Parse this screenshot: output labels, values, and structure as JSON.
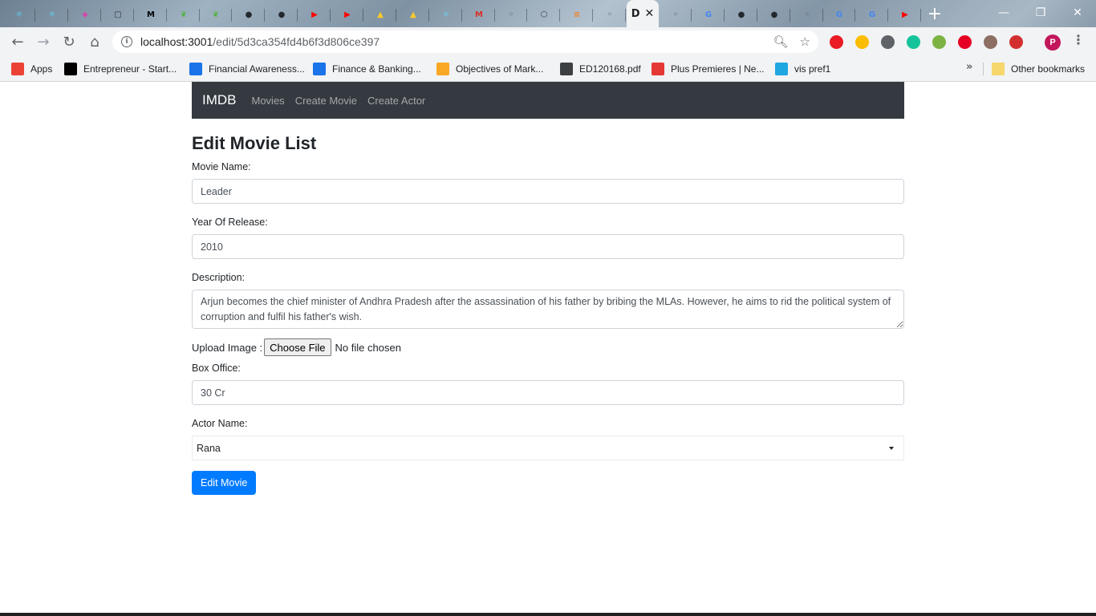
{
  "browser": {
    "tabs": [
      {
        "icon": "react-icon",
        "color": "#61dafb",
        "glyph": "⚛"
      },
      {
        "icon": "react-icon",
        "color": "#61dafb",
        "glyph": "⚛"
      },
      {
        "icon": "graphql-icon",
        "color": "#e535ab",
        "glyph": "◈"
      },
      {
        "icon": "square-icon",
        "color": "#263238",
        "glyph": "▢"
      },
      {
        "icon": "medium-icon",
        "color": "#000000",
        "glyph": "M"
      },
      {
        "icon": "mongodb-icon",
        "color": "#4db33d",
        "glyph": "❦"
      },
      {
        "icon": "mongodb-icon",
        "color": "#4db33d",
        "glyph": "❦"
      },
      {
        "icon": "github-icon",
        "color": "#24292e",
        "glyph": "●"
      },
      {
        "icon": "github-icon",
        "color": "#24292e",
        "glyph": "●"
      },
      {
        "icon": "youtube-icon",
        "color": "#ff0000",
        "glyph": "▶"
      },
      {
        "icon": "youtube-icon",
        "color": "#ff0000",
        "glyph": "▶"
      },
      {
        "icon": "firebase-icon",
        "color": "#ffca28",
        "glyph": "▲"
      },
      {
        "icon": "firebase-icon",
        "color": "#ffca28",
        "glyph": "▲"
      },
      {
        "icon": "react-icon",
        "color": "#61dafb",
        "glyph": "⚛"
      },
      {
        "icon": "gmail-icon",
        "color": "#d93025",
        "glyph": "M"
      },
      {
        "icon": "tab-icon",
        "color": "#5f6368",
        "glyph": "◦"
      },
      {
        "icon": "codesandbox-icon",
        "color": "#3c4043",
        "glyph": "⬡"
      },
      {
        "icon": "stackoverflow-icon",
        "color": "#f48024",
        "glyph": "≡"
      },
      {
        "icon": "tab-icon",
        "color": "#5f6368",
        "glyph": "◦"
      },
      {
        "icon": "tab-icon",
        "color": "#5f6368",
        "glyph": "◦"
      },
      {
        "icon": "google-icon",
        "color": "#4285f4",
        "glyph": "G"
      },
      {
        "icon": "github-icon",
        "color": "#24292e",
        "glyph": "●"
      },
      {
        "icon": "github-icon",
        "color": "#24292e",
        "glyph": "●"
      },
      {
        "icon": "tab-icon",
        "color": "#5f6368",
        "glyph": "◦"
      },
      {
        "icon": "google-icon",
        "color": "#4285f4",
        "glyph": "G"
      },
      {
        "icon": "google-icon",
        "color": "#4285f4",
        "glyph": "G"
      },
      {
        "icon": "youtube-icon",
        "color": "#ff0000",
        "glyph": "▶"
      }
    ],
    "active_tab_label": "D",
    "url_host": "localhost:3001",
    "url_path": "/edit/5d3ca354fd4b6f3d806ce397",
    "profile_initial": "P",
    "extensions": [
      "#ea1b22",
      "#fbbc04",
      "#5f6368",
      "#15c39a",
      "#7cb342",
      "#e60023",
      "#8d6e63",
      "#d32f2f"
    ],
    "bookmarks": [
      {
        "label": "Apps",
        "icon": "apps-grid-icon",
        "color": "#ea4335"
      },
      {
        "label": "Entrepreneur - Start...",
        "icon": "entrepreneur-icon",
        "color": "#000000"
      },
      {
        "label": "Financial Awareness...",
        "icon": "bookmark-site-icon",
        "color": "#1a73e8"
      },
      {
        "label": "Finance & Banking...",
        "icon": "bookmark-site-icon",
        "color": "#1a73e8"
      },
      {
        "label": "Objectives of Mark...",
        "icon": "bookmark-site-icon",
        "color": "#f9a825"
      },
      {
        "label": "ED120168.pdf",
        "icon": "globe-icon",
        "color": "#3c4043"
      },
      {
        "label": "Plus Premieres | Ne...",
        "icon": "bars-chart-icon",
        "color": "#e53935"
      },
      {
        "label": "vis pref1",
        "icon": "ie-icon",
        "color": "#1ea7e1"
      }
    ],
    "other_bookmarks": "Other bookmarks"
  },
  "navbar": {
    "brand": "IMDB",
    "links": [
      "Movies",
      "Create Movie",
      "Create Actor"
    ]
  },
  "form": {
    "title": "Edit Movie List",
    "movie_name_label": "Movie Name:",
    "movie_name_value": "Leader",
    "year_label": "Year Of Release:",
    "year_value": "2010",
    "description_label": "Description:",
    "description_value": "Arjun becomes the chief minister of Andhra Pradesh after the assassination of his father by bribing the MLAs. However, he aims to rid the political system of corruption and fulfil his father's wish.",
    "upload_label": "Upload Image :",
    "choose_file_label": "Choose File",
    "file_status": "No file chosen",
    "box_office_label": "Box Office:",
    "box_office_value": "30 Cr",
    "actor_label": "Actor Name:",
    "actor_selected": "Rana",
    "submit_label": "Edit Movie"
  }
}
